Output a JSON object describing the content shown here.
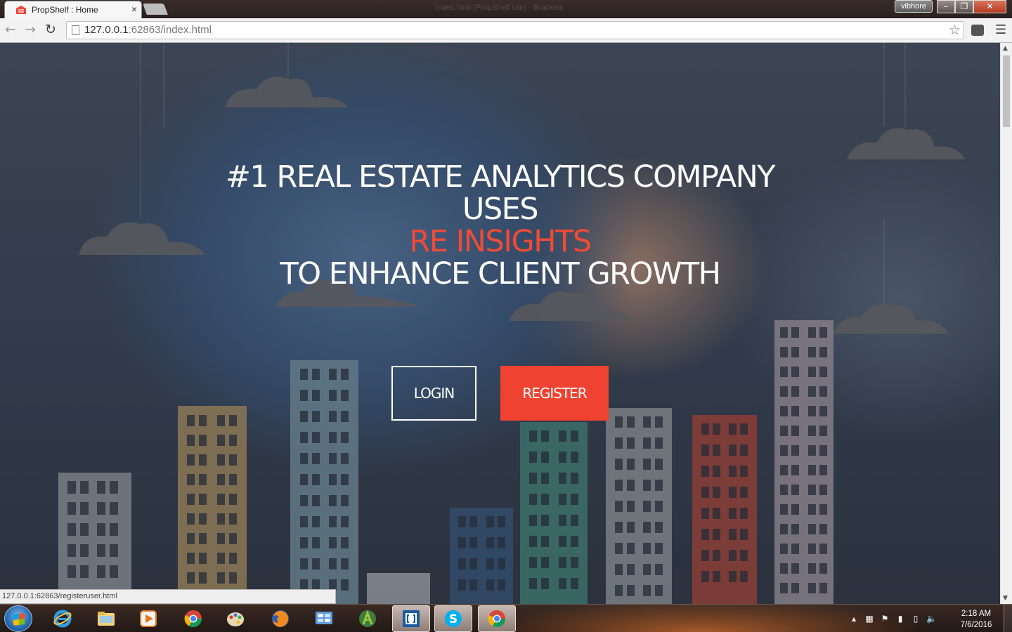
{
  "browser": {
    "tab_title": "PropShelf : Home",
    "tab_close": "×",
    "window_title": "index.html (PropShelf site) - Brackets",
    "user_badge": "vibhore",
    "win_minimize": "–",
    "win_maximize": "❐",
    "win_close": "✕",
    "url_host": "127.0.0.1",
    "url_rest": ":62863/index.html",
    "status_url": "127.0.0.1:62863/registeruser.html"
  },
  "hero": {
    "line1": "#1 REAL ESTATE ANALYTICS COMPANY",
    "line2": "USES",
    "accent": "RE INSIGHTS",
    "line4": "TO ENHANCE CLIENT GROWTH",
    "login_label": "LOGIN",
    "register_label": "REGISTER",
    "accent_color": "#ef4b36",
    "register_color": "#ef4230"
  },
  "taskbar": {
    "apps": [
      {
        "name": "internet-explorer",
        "icon": "ie-icon",
        "active": false
      },
      {
        "name": "file-explorer",
        "icon": "folder-icon",
        "active": false
      },
      {
        "name": "media-player",
        "icon": "media-icon",
        "active": false
      },
      {
        "name": "chrome",
        "icon": "chrome-icon",
        "active": false
      },
      {
        "name": "paint",
        "icon": "paint-icon",
        "active": false
      },
      {
        "name": "firefox",
        "icon": "firefox-icon",
        "active": false
      },
      {
        "name": "control-panel",
        "icon": "control-panel-icon",
        "active": false
      },
      {
        "name": "android-studio",
        "icon": "android-icon",
        "active": false
      },
      {
        "name": "brackets",
        "icon": "brackets-icon",
        "active": true
      },
      {
        "name": "skype",
        "icon": "skype-icon",
        "active": true
      },
      {
        "name": "chrome-active",
        "icon": "chrome-icon",
        "active": true
      }
    ],
    "time": "2:18 AM",
    "date": "7/6/2016"
  }
}
